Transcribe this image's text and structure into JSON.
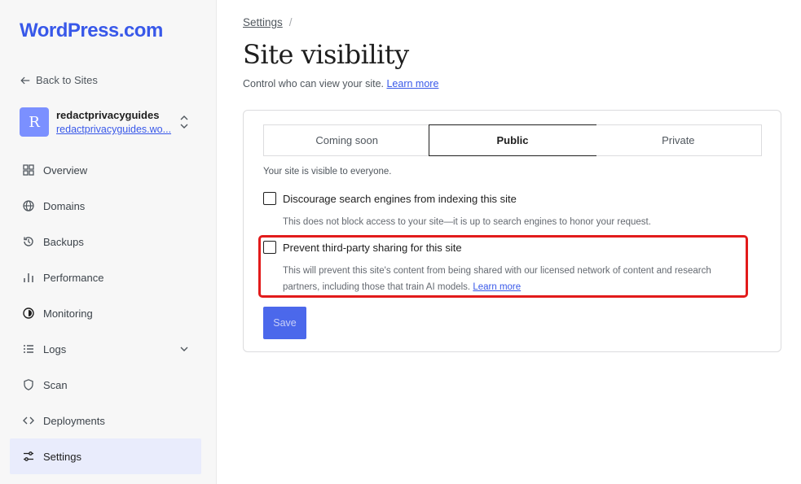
{
  "brand": {
    "logo_text": "WordPress.com",
    "accent": "#3858e9"
  },
  "sidebar": {
    "back_label": "Back to Sites",
    "site": {
      "avatar_letter": "R",
      "name": "redactprivacyguides",
      "url": "redactprivacyguides.wo..."
    },
    "items": [
      {
        "label": "Overview",
        "icon": "grid-icon"
      },
      {
        "label": "Domains",
        "icon": "globe-icon"
      },
      {
        "label": "Backups",
        "icon": "backup-icon"
      },
      {
        "label": "Performance",
        "icon": "bar-chart-icon"
      },
      {
        "label": "Monitoring",
        "icon": "monitor-icon"
      },
      {
        "label": "Logs",
        "icon": "list-icon"
      },
      {
        "label": "Scan",
        "icon": "shield-icon"
      },
      {
        "label": "Deployments",
        "icon": "code-icon"
      },
      {
        "label": "Settings",
        "icon": "sliders-icon",
        "active": true
      }
    ]
  },
  "main": {
    "breadcrumb": {
      "parent": "Settings",
      "separator": "/"
    },
    "title": "Site visibility",
    "subtitle": "Control who can view your site.",
    "subtitle_link": "Learn more",
    "visibility": {
      "options": [
        "Coming soon",
        "Public",
        "Private"
      ],
      "selected": "Public",
      "note": "Your site is visible to everyone."
    },
    "discourage": {
      "label": "Discourage search engines from indexing this site",
      "help": "This does not block access to your site—it is up to search engines to honor your request.",
      "checked": false
    },
    "prevent_sharing": {
      "label": "Prevent third-party sharing for this site",
      "help_line1": "This will prevent this site's content from being shared with our licensed network of content and research",
      "help_line2": "partners, including those that train AI models.",
      "help_link": "Learn more",
      "checked": false
    },
    "save_label": "Save"
  }
}
